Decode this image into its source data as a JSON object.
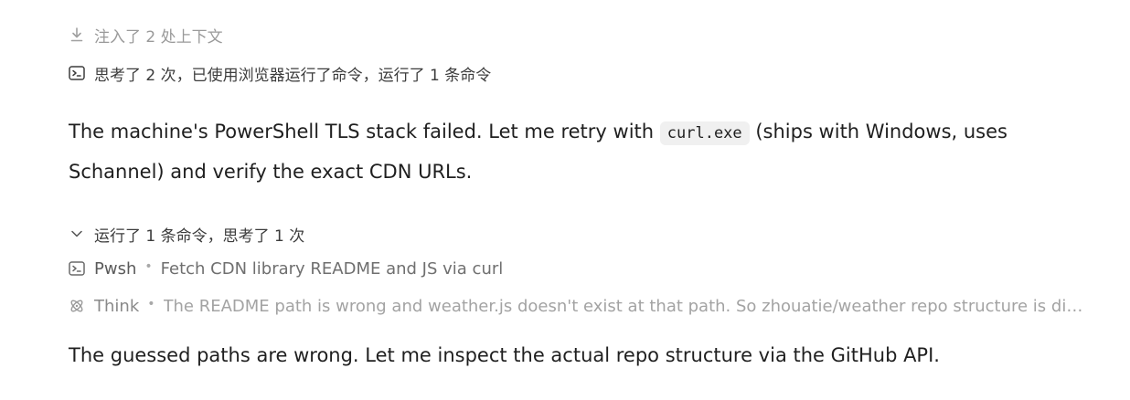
{
  "context_line": {
    "label": "注入了 2 处上下文",
    "icon": "download-icon"
  },
  "summary_line": {
    "label": "思考了 2 次，已使用浏览器运行了命令，运行了 1 条命令",
    "icon": "terminal-icon"
  },
  "message1": {
    "before": "The machine's PowerShell TLS stack failed. Let me retry with ",
    "code": "curl.exe",
    "after": " (ships with Windows, uses Schannel) and verify the exact CDN URLs."
  },
  "collapse_line": {
    "label": "运行了 1 条命令，思考了 1 次",
    "icon": "chevron-down-icon"
  },
  "steps": [
    {
      "name": "Pwsh",
      "desc": "Fetch CDN library README and JS via curl",
      "icon": "terminal-icon"
    },
    {
      "name": "Think",
      "desc": "The README path is wrong and weather.js doesn't exist at that path. So zhouatie/weather repo structure is different. Let me check the repository tree.",
      "icon": "brain-icon"
    }
  ],
  "message2": "The guessed paths are wrong. Let me inspect the actual repo structure via the GitHub API."
}
